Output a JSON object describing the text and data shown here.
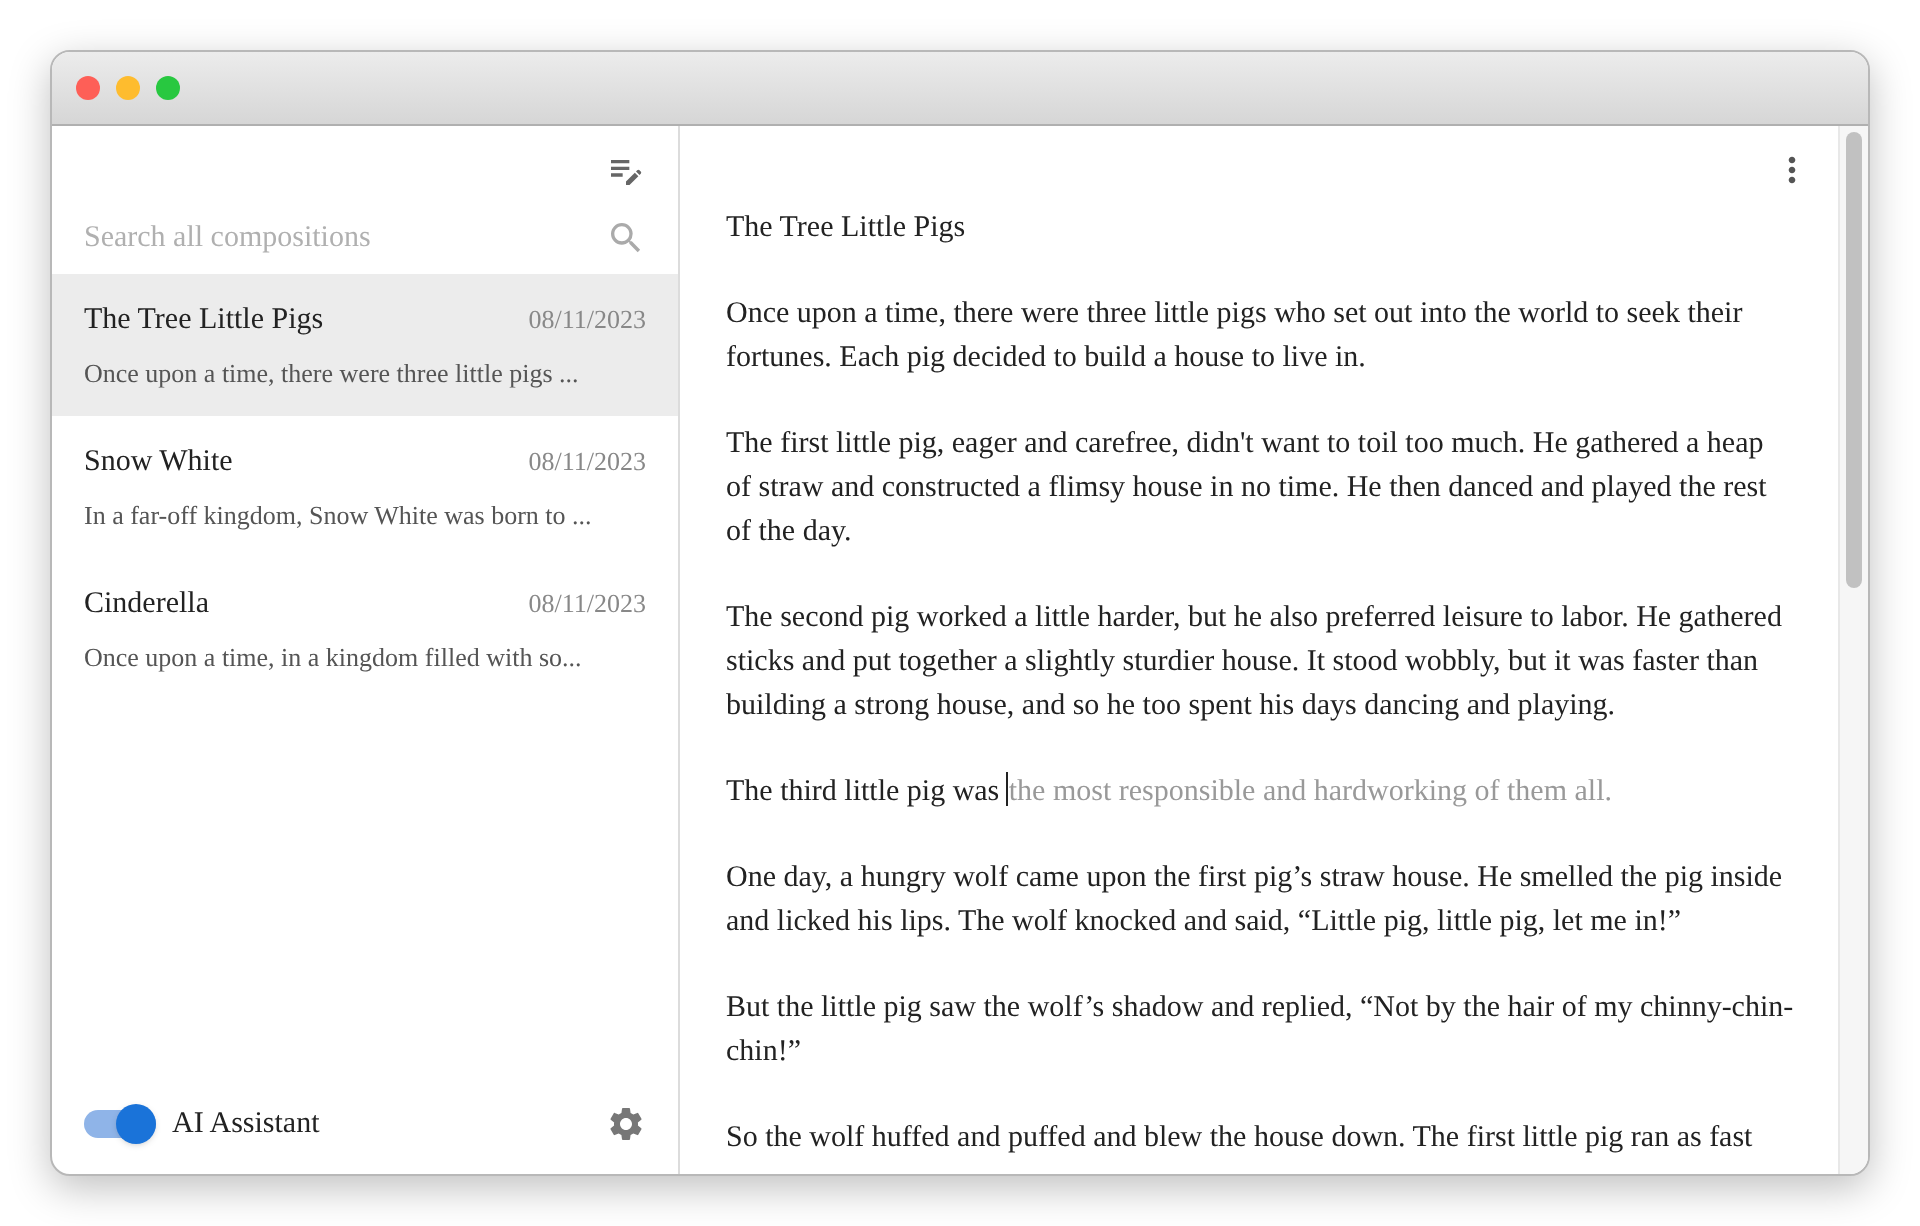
{
  "sidebar": {
    "search": {
      "placeholder": "Search all compositions"
    },
    "items": [
      {
        "title": "The Tree Little Pigs",
        "date": "08/11/2023",
        "preview": "Once upon a time, there were three little pigs ...",
        "selected": true
      },
      {
        "title": "Snow White",
        "date": "08/11/2023",
        "preview": "In a far-off kingdom, Snow White was born to ...",
        "selected": false
      },
      {
        "title": "Cinderella",
        "date": "08/11/2023",
        "preview": "Once upon a time, in a kingdom filled with so...",
        "selected": false
      }
    ],
    "assistant": {
      "label": "AI Assistant",
      "on": true
    }
  },
  "editor": {
    "paragraphs": [
      {
        "text": "The Tree Little Pigs"
      },
      {
        "text": "Once upon a time, there were three little pigs who set out into the world to seek their fortunes. Each pig decided to build a house to live in."
      },
      {
        "text": "The first little pig, eager and carefree, didn't want to toil too much. He gathered a heap of straw and constructed a flimsy house in no time. He then danced and played the rest of the day."
      },
      {
        "text": "The second pig worked a little harder, but he also preferred leisure to labor. He gathered sticks and put together a slightly sturdier house. It stood wobbly, but it was faster than building a strong house, and so he too spent his days dancing and playing."
      },
      {
        "text": "The third little pig was ",
        "suggestion": "the most responsible and hardworking of them all."
      },
      {
        "text": "One day, a hungry wolf came upon the first pig’s straw house. He smelled the pig inside and licked his lips. The wolf knocked and said, “Little pig, little pig, let me in!”"
      },
      {
        "text": "But the little pig saw the wolf’s shadow and replied, “Not by the hair of my chinny-chin-chin!”"
      },
      {
        "text": "So the wolf huffed and puffed and blew the house down. The first little pig ran as fast"
      }
    ]
  }
}
